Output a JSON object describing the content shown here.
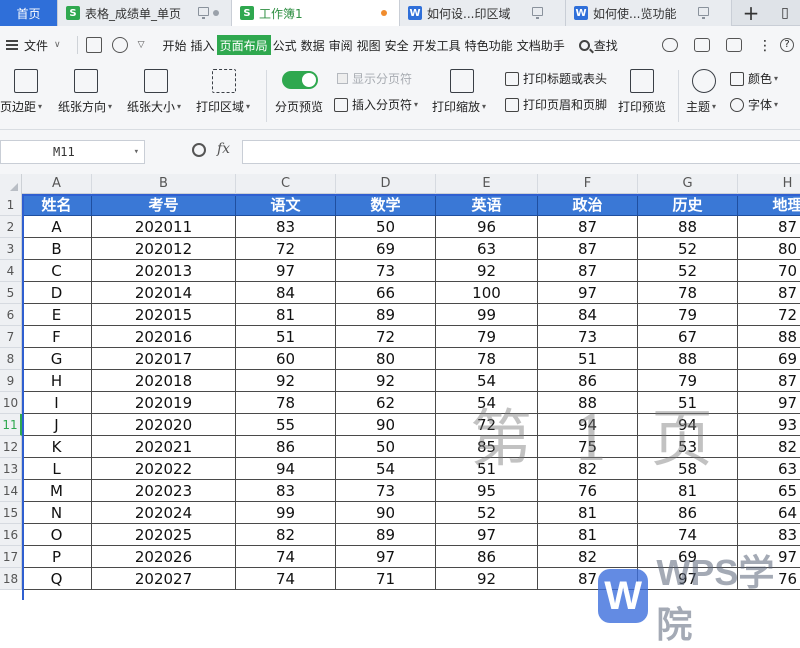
{
  "tabs": [
    {
      "label": "首页",
      "type": "home"
    },
    {
      "label": "表格_成绩单_单页",
      "type": "sheet"
    },
    {
      "label": "工作簿1",
      "type": "sheet",
      "active": true
    },
    {
      "label": "如何设...印区域",
      "type": "doc"
    },
    {
      "label": "如何使...览功能",
      "type": "doc"
    }
  ],
  "menubar": {
    "file": "文件",
    "items": [
      "开始",
      "插入",
      "页面布局",
      "公式",
      "数据",
      "审阅",
      "视图",
      "安全",
      "开发工具",
      "特色功能",
      "文档助手"
    ],
    "active": "页面布局",
    "find": "查找"
  },
  "ribbon": {
    "margins": "页边距",
    "orientation": "纸张方向",
    "size": "纸张大小",
    "print_area": "打印区域",
    "page_break_preview": "分页预览",
    "show_page_break": "显示分页符",
    "insert_page_break": "插入分页符",
    "print_scale": "打印缩放",
    "print_titles": "打印标题或表头",
    "header_footer": "打印页眉和页脚",
    "print_preview": "打印预览",
    "theme": "主题",
    "colors": "颜色",
    "fonts": "字体"
  },
  "formula_bar": {
    "cell_ref": "M11",
    "fx": "fx",
    "value": ""
  },
  "columns": [
    "A",
    "B",
    "C",
    "D",
    "E",
    "F",
    "G",
    "H"
  ],
  "row_numbers": [
    "1",
    "2",
    "3",
    "4",
    "5",
    "6",
    "7",
    "8",
    "9",
    "10",
    "11",
    "12",
    "13",
    "14",
    "15",
    "16",
    "17",
    "18"
  ],
  "selected_row": "11",
  "table": {
    "headers": [
      "姓名",
      "考号",
      "语文",
      "数学",
      "英语",
      "政治",
      "历史",
      "地理"
    ],
    "rows": [
      [
        "A",
        "202011",
        "83",
        "50",
        "96",
        "87",
        "88",
        "87"
      ],
      [
        "B",
        "202012",
        "72",
        "69",
        "63",
        "87",
        "52",
        "80"
      ],
      [
        "C",
        "202013",
        "97",
        "73",
        "92",
        "87",
        "52",
        "70"
      ],
      [
        "D",
        "202014",
        "84",
        "66",
        "100",
        "97",
        "78",
        "87"
      ],
      [
        "E",
        "202015",
        "81",
        "89",
        "99",
        "84",
        "79",
        "72"
      ],
      [
        "F",
        "202016",
        "51",
        "72",
        "79",
        "73",
        "67",
        "88"
      ],
      [
        "G",
        "202017",
        "60",
        "80",
        "78",
        "51",
        "88",
        "69"
      ],
      [
        "H",
        "202018",
        "92",
        "92",
        "54",
        "86",
        "79",
        "87"
      ],
      [
        "I",
        "202019",
        "78",
        "62",
        "54",
        "88",
        "51",
        "97"
      ],
      [
        "J",
        "202020",
        "55",
        "90",
        "72",
        "94",
        "94",
        "93"
      ],
      [
        "K",
        "202021",
        "86",
        "50",
        "85",
        "75",
        "53",
        "82"
      ],
      [
        "L",
        "202022",
        "94",
        "54",
        "51",
        "82",
        "58",
        "63"
      ],
      [
        "M",
        "202023",
        "83",
        "73",
        "95",
        "76",
        "81",
        "65"
      ],
      [
        "N",
        "202024",
        "99",
        "90",
        "52",
        "81",
        "86",
        "64"
      ],
      [
        "O",
        "202025",
        "82",
        "89",
        "97",
        "81",
        "74",
        "83"
      ],
      [
        "P",
        "202026",
        "74",
        "97",
        "86",
        "82",
        "69",
        "97"
      ],
      [
        "Q",
        "202027",
        "74",
        "71",
        "92",
        "87",
        "97",
        "76"
      ]
    ]
  },
  "watermark": "第 1 页",
  "logo_text": "WPS学院",
  "colors": {
    "accent": "#2fa84f",
    "header_fill": "#3a78d6",
    "page_break": "#2f5fd0"
  }
}
